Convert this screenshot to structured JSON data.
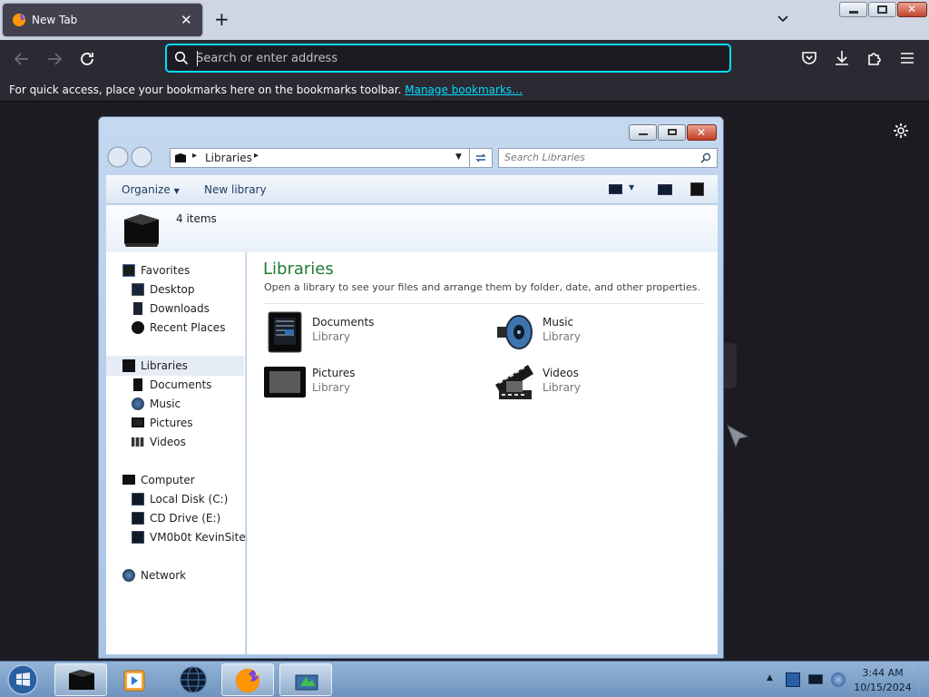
{
  "browser": {
    "tab_title": "New Tab",
    "url_placeholder": "Search or enter address",
    "bookmarks_message": "For quick access, place your bookmarks here on the bookmarks toolbar.",
    "manage_bookmarks": "Manage bookmarks…",
    "accent": "#00ddff"
  },
  "explorer": {
    "address": "Libraries",
    "search_placeholder": "Search Libraries",
    "organize": "Organize",
    "new_library": "New library",
    "item_count": "4 items",
    "heading": "Libraries",
    "subheading": "Open a library to see your files and arrange them by folder, date, and other properties.",
    "nav": {
      "favorites": "Favorites",
      "desktop": "Desktop",
      "downloads": "Downloads",
      "recent": "Recent Places",
      "libraries": "Libraries",
      "documents": "Documents",
      "music": "Music",
      "pictures": "Pictures",
      "videos": "Videos",
      "computer": "Computer",
      "local_disk": "Local Disk (C:)",
      "cd_drive": "CD Drive (E:)",
      "share": "VM0b0t KevinSite",
      "network": "Network"
    },
    "libraries": [
      {
        "name": "Documents",
        "type": "Library"
      },
      {
        "name": "Music",
        "type": "Library"
      },
      {
        "name": "Pictures",
        "type": "Library"
      },
      {
        "name": "Videos",
        "type": "Library"
      }
    ]
  },
  "taskbar": {
    "time": "3:44 AM",
    "date": "10/15/2024"
  }
}
